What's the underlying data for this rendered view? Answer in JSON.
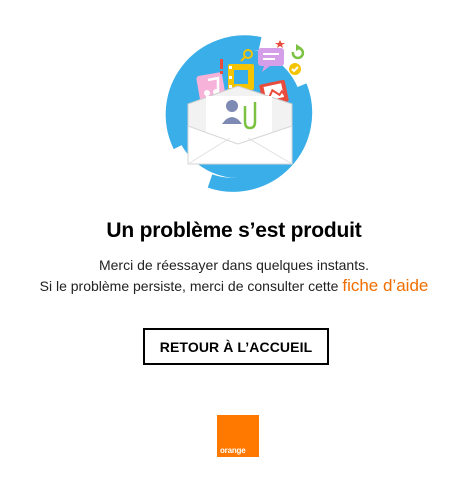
{
  "error": {
    "title": "Un problème s’est produit",
    "line1": "Merci de réessayer dans quelques instants.",
    "line2": "Si le problème persiste, merci de consulter cette",
    "help_link": "fiche d’aide"
  },
  "actions": {
    "home_button": "RETOUR À L’ACCUEIL"
  },
  "brand": {
    "logo_text": "orange",
    "color": "#ff7900"
  },
  "colors": {
    "circle": "#3aaee8",
    "link": "#f16e00"
  },
  "icons": [
    "envelope-icon",
    "user-icon",
    "music-note-icon",
    "film-icon",
    "speech-bubble-icon",
    "photo-icon",
    "paperclip-icon",
    "star-icon",
    "search-icon",
    "refresh-icon",
    "check-icon",
    "exclamation-icon"
  ]
}
